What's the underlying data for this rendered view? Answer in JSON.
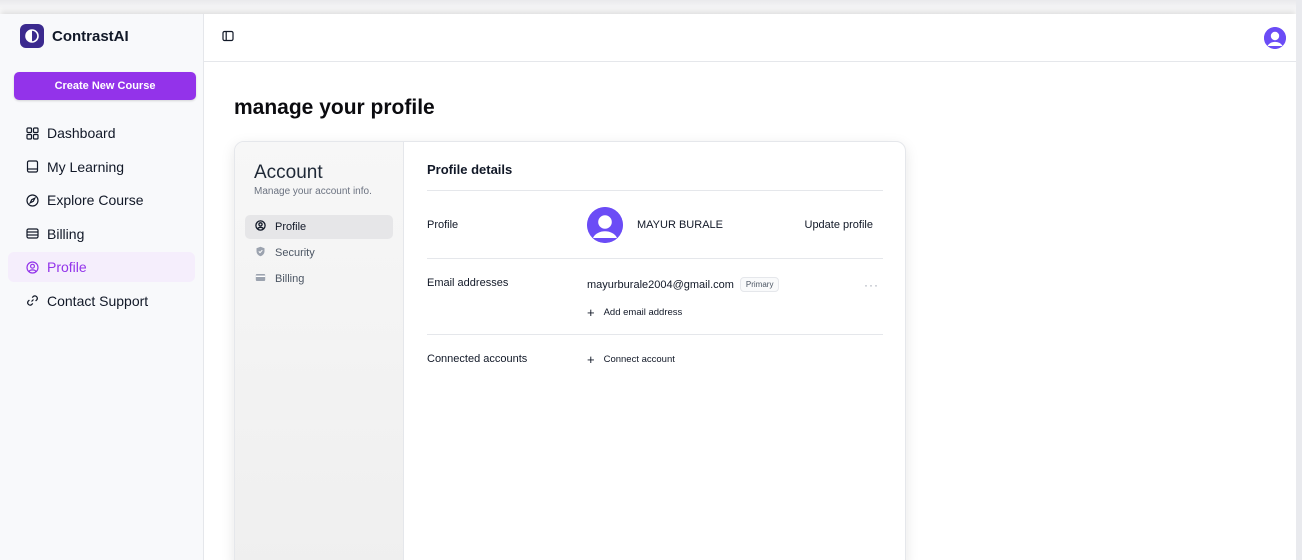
{
  "sidebar": {
    "brand": "ContrastAI",
    "create_button": "Create New Course",
    "items": [
      {
        "label": "Dashboard",
        "icon": "dashboard-icon"
      },
      {
        "label": "My Learning",
        "icon": "book-icon"
      },
      {
        "label": "Explore Course",
        "icon": "compass-icon"
      },
      {
        "label": "Billing",
        "icon": "wallet-icon"
      },
      {
        "label": "Profile",
        "icon": "user-circle-icon",
        "active": true
      },
      {
        "label": "Contact Support",
        "icon": "link-icon"
      }
    ]
  },
  "header": {
    "toggle_icon": "sidebar-toggle-icon",
    "avatar_icon": "user-avatar-icon"
  },
  "page": {
    "title": "manage your profile"
  },
  "account": {
    "title": "Account",
    "subtitle": "Manage your account info.",
    "nav": [
      {
        "label": "Profile",
        "icon": "user-icon",
        "active": true
      },
      {
        "label": "Security",
        "icon": "shield-icon"
      },
      {
        "label": "Billing",
        "icon": "credit-card-icon"
      }
    ]
  },
  "profile_details": {
    "title": "Profile details",
    "profile_label": "Profile",
    "name": "MAYUR BURALE",
    "update_link": "Update profile",
    "email_label": "Email addresses",
    "email": "mayurburale2004@gmail.com",
    "primary_badge": "Primary",
    "more_menu": "···",
    "add_email": "Add email address",
    "connected_label": "Connected accounts",
    "connect_account": "Connect account"
  },
  "colors": {
    "accent": "#9333ea",
    "avatar": "#6b4cf6",
    "brand_logo": "#3b2a8e"
  }
}
